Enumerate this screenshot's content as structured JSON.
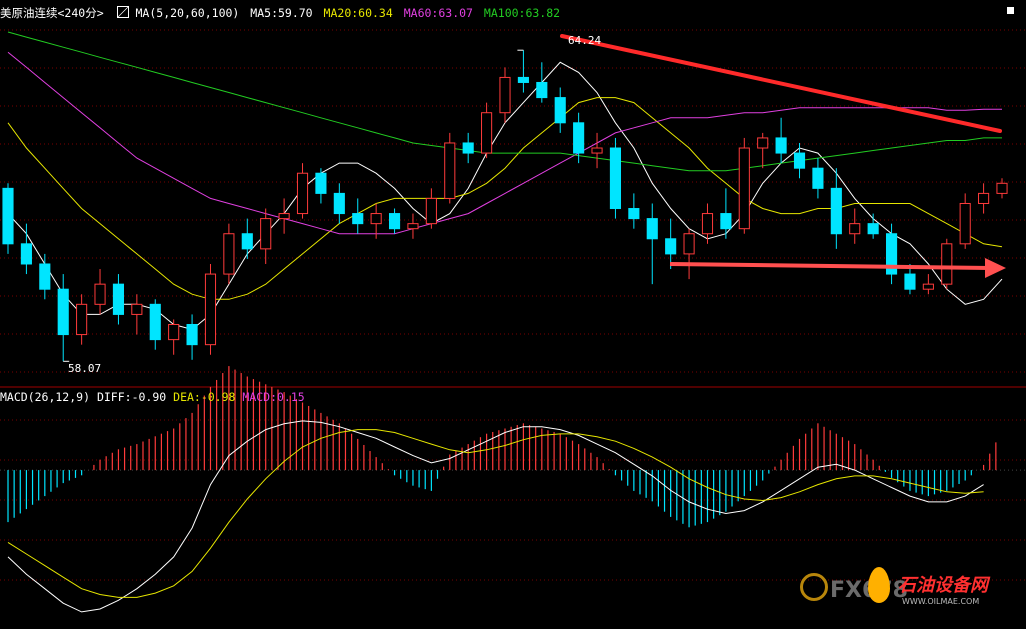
{
  "header": {
    "instrument": "美原油连续",
    "period": "<240分>",
    "ma_label": "MA(5,20,60,100)",
    "ma5": "MA5:59.70",
    "ma20": "MA20:60.34",
    "ma60": "MA60:63.07",
    "ma100": "MA100:63.82"
  },
  "colors": {
    "up": "#ff3b3b",
    "down": "#00e5ff",
    "ma5": "#ffffff",
    "ma20": "#e6e600",
    "ma60": "#e040e0",
    "ma100": "#22cc22",
    "grid": "#7a0000",
    "trendline": "#ff2a2a",
    "arrow": "#ff5050"
  },
  "icons": {
    "ma_toggle": "ma-toggle-icon",
    "corner": "corner-marker-icon"
  },
  "price_labels": {
    "high": "64.24",
    "low": "58.07"
  },
  "macd_header": {
    "label": "MACD(26,12,9)",
    "diff": "DIFF:-0.90",
    "dea": "DEA:-0.98",
    "macd": "MACD:0.15"
  },
  "watermark": {
    "left": "FX678",
    "right": "石油设备网",
    "url": "WWW.OILMAE.COM"
  },
  "chart_data": [
    {
      "type": "candlestick",
      "series": [
        {
          "name": "MA5",
          "values": [
            61.0,
            60.6,
            60.0,
            59.4,
            59.0,
            59.0,
            59.2,
            59.2,
            59.1,
            58.8,
            58.7,
            59.0,
            59.6,
            60.2,
            60.6,
            61.0,
            61.5,
            61.8,
            62.0,
            62.0,
            61.8,
            61.5,
            61.1,
            60.8,
            61.0,
            61.5,
            62.2,
            62.8,
            63.2,
            63.6,
            64.0,
            63.8,
            63.4,
            62.8,
            62.3,
            61.6,
            61.1,
            60.7,
            60.5,
            60.6,
            61.0,
            61.6,
            62.0,
            62.3,
            62.2,
            61.8,
            61.3,
            60.9,
            60.6,
            60.4,
            60.0,
            59.5,
            59.2,
            59.3,
            59.7
          ]
        },
        {
          "name": "MA20",
          "values": [
            62.8,
            62.3,
            61.9,
            61.5,
            61.1,
            60.8,
            60.5,
            60.2,
            59.9,
            59.6,
            59.4,
            59.3,
            59.3,
            59.4,
            59.6,
            59.9,
            60.2,
            60.5,
            60.8,
            61.0,
            61.2,
            61.3,
            61.3,
            61.3,
            61.3,
            61.4,
            61.6,
            61.9,
            62.3,
            62.6,
            62.9,
            63.2,
            63.3,
            63.3,
            63.2,
            62.9,
            62.6,
            62.3,
            61.9,
            61.6,
            61.3,
            61.1,
            61.0,
            61.0,
            61.1,
            61.1,
            61.2,
            61.2,
            61.2,
            61.2,
            61.0,
            60.8,
            60.6,
            60.4,
            60.34
          ]
        },
        {
          "name": "MA60",
          "values": [
            64.2,
            63.9,
            63.6,
            63.3,
            63.0,
            62.7,
            62.4,
            62.1,
            61.9,
            61.7,
            61.5,
            61.3,
            61.2,
            61.1,
            61.0,
            60.9,
            60.8,
            60.7,
            60.6,
            60.6,
            60.6,
            60.6,
            60.7,
            60.8,
            60.9,
            61.0,
            61.2,
            61.4,
            61.6,
            61.8,
            62.0,
            62.2,
            62.4,
            62.6,
            62.7,
            62.8,
            62.9,
            62.9,
            62.9,
            62.95,
            63.0,
            63.0,
            63.05,
            63.1,
            63.1,
            63.1,
            63.1,
            63.1,
            63.1,
            63.1,
            63.1,
            63.05,
            63.05,
            63.07,
            63.07
          ]
        },
        {
          "name": "MA100",
          "values": [
            64.6,
            64.5,
            64.4,
            64.3,
            64.2,
            64.1,
            64.0,
            63.9,
            63.8,
            63.7,
            63.6,
            63.5,
            63.4,
            63.3,
            63.2,
            63.1,
            63.0,
            62.9,
            62.8,
            62.7,
            62.6,
            62.5,
            62.4,
            62.35,
            62.3,
            62.25,
            62.2,
            62.2,
            62.2,
            62.2,
            62.2,
            62.15,
            62.1,
            62.05,
            62.0,
            61.95,
            61.9,
            61.85,
            61.85,
            61.85,
            61.9,
            61.95,
            62.0,
            62.05,
            62.1,
            62.15,
            62.2,
            62.25,
            62.3,
            62.35,
            62.4,
            62.45,
            62.45,
            62.5,
            62.5
          ]
        }
      ],
      "candles": [
        {
          "o": 61.5,
          "h": 61.6,
          "l": 60.2,
          "c": 60.4
        },
        {
          "o": 60.4,
          "h": 60.8,
          "l": 59.8,
          "c": 60.0
        },
        {
          "o": 60.0,
          "h": 60.2,
          "l": 59.3,
          "c": 59.5
        },
        {
          "o": 59.5,
          "h": 59.8,
          "l": 58.07,
          "c": 58.6
        },
        {
          "o": 58.6,
          "h": 59.4,
          "l": 58.4,
          "c": 59.2
        },
        {
          "o": 59.2,
          "h": 59.9,
          "l": 59.0,
          "c": 59.6
        },
        {
          "o": 59.6,
          "h": 59.8,
          "l": 58.8,
          "c": 59.0
        },
        {
          "o": 59.0,
          "h": 59.4,
          "l": 58.6,
          "c": 59.2
        },
        {
          "o": 59.2,
          "h": 59.3,
          "l": 58.3,
          "c": 58.5
        },
        {
          "o": 58.5,
          "h": 58.9,
          "l": 58.2,
          "c": 58.8
        },
        {
          "o": 58.8,
          "h": 59.0,
          "l": 58.1,
          "c": 58.4
        },
        {
          "o": 58.4,
          "h": 60.0,
          "l": 58.2,
          "c": 59.8
        },
        {
          "o": 59.8,
          "h": 60.8,
          "l": 59.6,
          "c": 60.6
        },
        {
          "o": 60.6,
          "h": 60.9,
          "l": 60.1,
          "c": 60.3
        },
        {
          "o": 60.3,
          "h": 61.1,
          "l": 60.0,
          "c": 60.9
        },
        {
          "o": 60.9,
          "h": 61.3,
          "l": 60.6,
          "c": 61.0
        },
        {
          "o": 61.0,
          "h": 62.0,
          "l": 60.9,
          "c": 61.8
        },
        {
          "o": 61.8,
          "h": 61.9,
          "l": 61.2,
          "c": 61.4
        },
        {
          "o": 61.4,
          "h": 61.6,
          "l": 60.8,
          "c": 61.0
        },
        {
          "o": 61.0,
          "h": 61.3,
          "l": 60.6,
          "c": 60.8
        },
        {
          "o": 60.8,
          "h": 61.2,
          "l": 60.5,
          "c": 61.0
        },
        {
          "o": 61.0,
          "h": 61.1,
          "l": 60.6,
          "c": 60.7
        },
        {
          "o": 60.7,
          "h": 61.0,
          "l": 60.5,
          "c": 60.8
        },
        {
          "o": 60.8,
          "h": 61.5,
          "l": 60.7,
          "c": 61.3
        },
        {
          "o": 61.3,
          "h": 62.6,
          "l": 61.2,
          "c": 62.4
        },
        {
          "o": 62.4,
          "h": 62.6,
          "l": 62.0,
          "c": 62.2
        },
        {
          "o": 62.2,
          "h": 63.2,
          "l": 62.1,
          "c": 63.0
        },
        {
          "o": 63.0,
          "h": 63.9,
          "l": 62.8,
          "c": 63.7
        },
        {
          "o": 63.7,
          "h": 64.24,
          "l": 63.4,
          "c": 63.6
        },
        {
          "o": 63.6,
          "h": 64.0,
          "l": 63.2,
          "c": 63.3
        },
        {
          "o": 63.3,
          "h": 63.5,
          "l": 62.6,
          "c": 62.8
        },
        {
          "o": 62.8,
          "h": 63.0,
          "l": 62.0,
          "c": 62.2
        },
        {
          "o": 62.2,
          "h": 62.6,
          "l": 61.9,
          "c": 62.3
        },
        {
          "o": 62.3,
          "h": 62.5,
          "l": 60.9,
          "c": 61.1
        },
        {
          "o": 61.1,
          "h": 61.4,
          "l": 60.7,
          "c": 60.9
        },
        {
          "o": 60.9,
          "h": 61.2,
          "l": 59.6,
          "c": 60.5
        },
        {
          "o": 60.5,
          "h": 60.9,
          "l": 59.9,
          "c": 60.2
        },
        {
          "o": 60.2,
          "h": 60.7,
          "l": 59.7,
          "c": 60.6
        },
        {
          "o": 60.6,
          "h": 61.2,
          "l": 60.4,
          "c": 61.0
        },
        {
          "o": 61.0,
          "h": 61.5,
          "l": 60.5,
          "c": 60.7
        },
        {
          "o": 60.7,
          "h": 62.5,
          "l": 60.6,
          "c": 62.3
        },
        {
          "o": 62.3,
          "h": 62.6,
          "l": 61.9,
          "c": 62.5
        },
        {
          "o": 62.5,
          "h": 62.9,
          "l": 62.0,
          "c": 62.2
        },
        {
          "o": 62.2,
          "h": 62.4,
          "l": 61.7,
          "c": 61.9
        },
        {
          "o": 61.9,
          "h": 62.1,
          "l": 61.3,
          "c": 61.5
        },
        {
          "o": 61.5,
          "h": 61.9,
          "l": 60.3,
          "c": 60.6
        },
        {
          "o": 60.6,
          "h": 61.1,
          "l": 60.4,
          "c": 60.8
        },
        {
          "o": 60.8,
          "h": 61.0,
          "l": 60.5,
          "c": 60.6
        },
        {
          "o": 60.6,
          "h": 60.8,
          "l": 59.6,
          "c": 59.8
        },
        {
          "o": 59.8,
          "h": 60.0,
          "l": 59.4,
          "c": 59.5
        },
        {
          "o": 59.5,
          "h": 59.8,
          "l": 59.4,
          "c": 59.6
        },
        {
          "o": 59.6,
          "h": 60.5,
          "l": 59.5,
          "c": 60.4
        },
        {
          "o": 60.4,
          "h": 61.4,
          "l": 60.3,
          "c": 61.2
        },
        {
          "o": 61.2,
          "h": 61.6,
          "l": 61.0,
          "c": 61.4
        },
        {
          "o": 61.4,
          "h": 61.7,
          "l": 61.3,
          "c": 61.6
        }
      ],
      "annotations": [
        "64.24",
        "58.07"
      ],
      "drawings": [
        "descending trendline across highs",
        "horizontal support arrow pointing right"
      ]
    },
    {
      "type": "bar",
      "title": "MACD(26,12,9)",
      "series": [
        {
          "name": "MACD",
          "values": [
            -0.2,
            -0.15,
            -0.1,
            -0.05,
            -0.02,
            0.04,
            0.08,
            0.1,
            0.13,
            0.16,
            0.22,
            0.32,
            0.4,
            0.36,
            0.33,
            0.3,
            0.26,
            0.22,
            0.18,
            0.12,
            0.05,
            -0.02,
            -0.06,
            -0.08,
            0.06,
            0.1,
            0.14,
            0.16,
            0.18,
            0.16,
            0.14,
            0.1,
            0.05,
            -0.02,
            -0.08,
            -0.12,
            -0.18,
            -0.22,
            -0.2,
            -0.16,
            -0.1,
            -0.04,
            0.04,
            0.12,
            0.18,
            0.14,
            0.1,
            0.04,
            -0.03,
            -0.08,
            -0.1,
            -0.08,
            -0.04,
            0.02,
            0.15
          ]
        },
        {
          "name": "DIFF",
          "values": [
            -0.6,
            -0.72,
            -0.82,
            -0.92,
            -0.98,
            -0.96,
            -0.9,
            -0.82,
            -0.72,
            -0.6,
            -0.4,
            -0.1,
            0.1,
            0.2,
            0.28,
            0.32,
            0.34,
            0.33,
            0.3,
            0.26,
            0.22,
            0.16,
            0.1,
            0.05,
            0.08,
            0.14,
            0.2,
            0.26,
            0.3,
            0.3,
            0.28,
            0.24,
            0.18,
            0.12,
            0.04,
            -0.04,
            -0.14,
            -0.22,
            -0.27,
            -0.3,
            -0.28,
            -0.22,
            -0.14,
            -0.06,
            0.02,
            0.04,
            0.0,
            -0.06,
            -0.12,
            -0.18,
            -0.22,
            -0.22,
            -0.18,
            -0.1,
            -0.9
          ]
        },
        {
          "name": "DEA",
          "values": [
            -0.5,
            -0.58,
            -0.66,
            -0.74,
            -0.82,
            -0.86,
            -0.88,
            -0.88,
            -0.85,
            -0.8,
            -0.7,
            -0.54,
            -0.36,
            -0.2,
            -0.06,
            0.06,
            0.16,
            0.22,
            0.26,
            0.28,
            0.28,
            0.26,
            0.22,
            0.18,
            0.14,
            0.12,
            0.14,
            0.17,
            0.21,
            0.24,
            0.25,
            0.25,
            0.23,
            0.2,
            0.15,
            0.09,
            0.02,
            -0.06,
            -0.12,
            -0.17,
            -0.2,
            -0.21,
            -0.19,
            -0.15,
            -0.1,
            -0.06,
            -0.04,
            -0.04,
            -0.06,
            -0.09,
            -0.12,
            -0.15,
            -0.16,
            -0.15,
            -0.98
          ]
        }
      ]
    }
  ]
}
